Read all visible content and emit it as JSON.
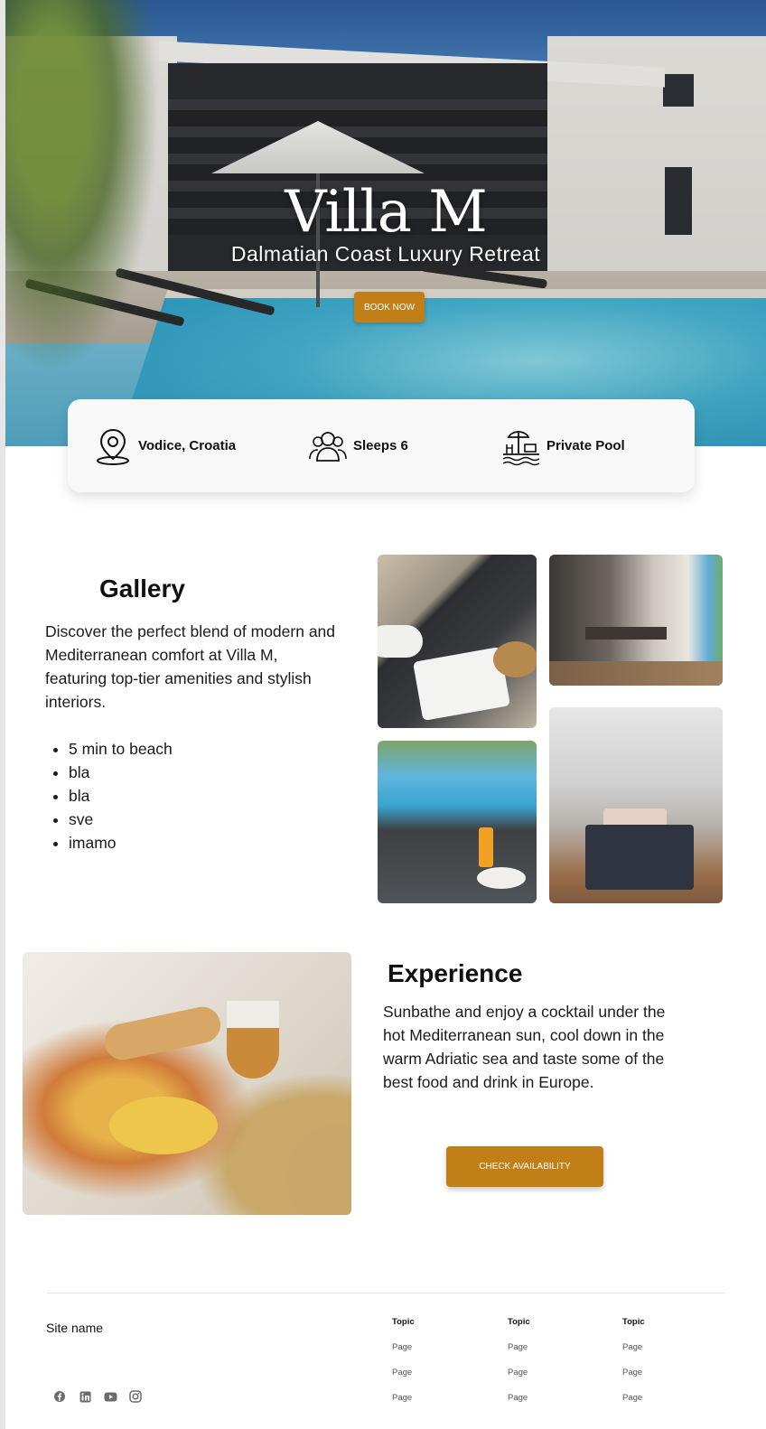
{
  "hero": {
    "title": "Villa M",
    "subtitle": "Dalmatian Coast Luxury Retreat",
    "book_label": "BOOK NOW"
  },
  "features": [
    {
      "icon": "map-pin-icon",
      "label": "Vodice, Croatia"
    },
    {
      "icon": "users-icon",
      "label": "Sleeps 6"
    },
    {
      "icon": "pool-umbrella-icon",
      "label": "Private Pool"
    }
  ],
  "gallery": {
    "title": "Gallery",
    "text": "Discover the perfect blend of modern and Mediterranean comfort at Villa M, featuring top-tier amenities and stylish interiors.",
    "items": [
      "5 min to beach",
      "bla",
      "bla",
      "sve",
      "imamo"
    ]
  },
  "experience": {
    "title": "Experience",
    "text": "Sunbathe and enjoy a cocktail under the hot Mediterranean sun, cool down in the warm Adriatic sea and taste some of the best food and drink in Europe.",
    "button_label": "CHECK AVAILABILITY"
  },
  "footer": {
    "site_name": "Site name",
    "social_icons": [
      "facebook-icon",
      "linkedin-icon",
      "youtube-icon",
      "instagram-icon"
    ],
    "columns": [
      {
        "topic": "Topic",
        "pages": [
          "Page",
          "Page",
          "Page"
        ]
      },
      {
        "topic": "Topic",
        "pages": [
          "Page",
          "Page",
          "Page"
        ]
      },
      {
        "topic": "Topic",
        "pages": [
          "Page",
          "Page",
          "Page"
        ]
      }
    ]
  },
  "colors": {
    "accent": "#c27f18"
  }
}
